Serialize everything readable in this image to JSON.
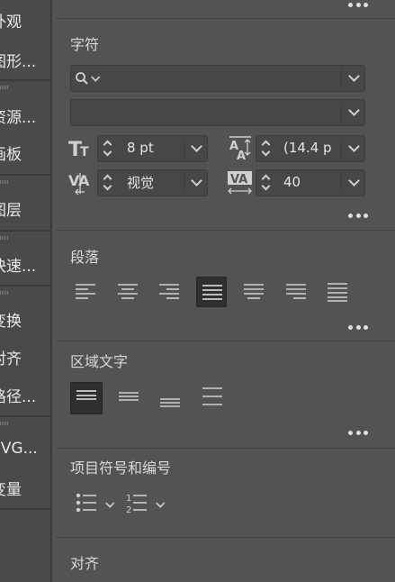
{
  "left_strip": {
    "items": [
      {
        "label": "外观"
      },
      {
        "label": "图形..."
      },
      {
        "label": "资源..."
      },
      {
        "label": "画板"
      },
      {
        "label": "图层"
      },
      {
        "label": "快速..."
      },
      {
        "label": "变换"
      },
      {
        "label": "对齐"
      },
      {
        "label": "路径..."
      },
      {
        "label": "SVG..."
      },
      {
        "label": "变量"
      }
    ]
  },
  "character": {
    "title": "字符",
    "font_family_value": "",
    "font_style_value": "",
    "font_size": "8 pt",
    "leading": "(14.4 p",
    "kerning": "视觉",
    "tracking": "40"
  },
  "paragraph": {
    "title": "段落",
    "options": [
      {
        "name": "align-left"
      },
      {
        "name": "align-center"
      },
      {
        "name": "align-right"
      },
      {
        "name": "justify-last-left"
      },
      {
        "name": "justify-last-center"
      },
      {
        "name": "justify-last-right"
      },
      {
        "name": "justify-all"
      }
    ],
    "selected": "justify-last-left"
  },
  "area_type": {
    "title": "区域文字",
    "selected": "align-top"
  },
  "bullets": {
    "title": "项目符号和编号"
  },
  "align_section": {
    "title": "对齐"
  }
}
